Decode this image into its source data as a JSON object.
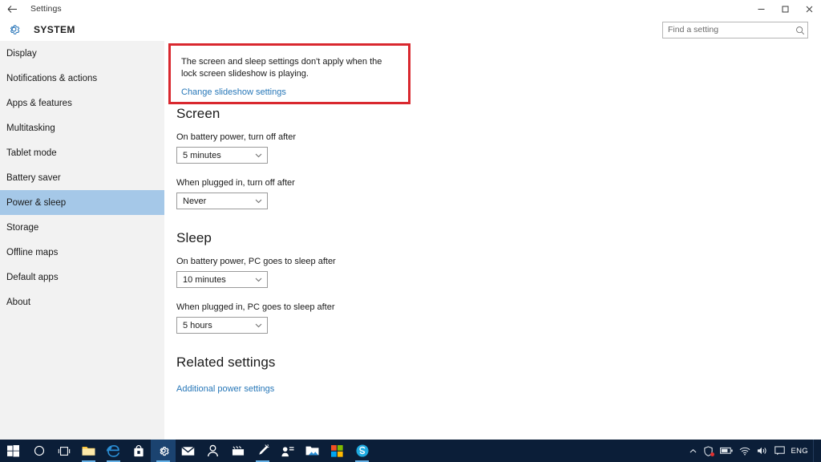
{
  "window": {
    "title": "Settings",
    "back_icon": "back-arrow-icon",
    "controls": {
      "minimize": "minimize-icon",
      "maximize": "maximize-icon",
      "close": "close-icon"
    }
  },
  "header": {
    "icon": "gear-icon",
    "title": "SYSTEM"
  },
  "search": {
    "placeholder": "Find a setting",
    "value": "",
    "icon": "search-icon"
  },
  "sidebar": {
    "items": [
      {
        "label": "Display",
        "selected": false
      },
      {
        "label": "Notifications & actions",
        "selected": false
      },
      {
        "label": "Apps & features",
        "selected": false
      },
      {
        "label": "Multitasking",
        "selected": false
      },
      {
        "label": "Tablet mode",
        "selected": false
      },
      {
        "label": "Battery saver",
        "selected": false
      },
      {
        "label": "Power & sleep",
        "selected": true
      },
      {
        "label": "Storage",
        "selected": false
      },
      {
        "label": "Offline maps",
        "selected": false
      },
      {
        "label": "Default apps",
        "selected": false
      },
      {
        "label": "About",
        "selected": false
      }
    ],
    "selected_bg": "#a5c8e8"
  },
  "info_box": {
    "text": "The screen and sleep settings don't apply when the lock screen slideshow is playing.",
    "link": "Change slideshow settings",
    "highlight_color": "#d9282f"
  },
  "screen_section": {
    "title": "Screen",
    "fields": [
      {
        "label": "On battery power, turn off after",
        "value": "5 minutes"
      },
      {
        "label": "When plugged in, turn off after",
        "value": "Never"
      }
    ]
  },
  "sleep_section": {
    "title": "Sleep",
    "fields": [
      {
        "label": "On battery power, PC goes to sleep after",
        "value": "10 minutes"
      },
      {
        "label": "When plugged in, PC goes to sleep after",
        "value": "5 hours"
      }
    ]
  },
  "related_section": {
    "title": "Related settings",
    "link": "Additional power settings"
  },
  "taskbar": {
    "items": [
      {
        "name": "start-button",
        "icon": "windows-logo-icon"
      },
      {
        "name": "cortana-button",
        "icon": "circle-icon"
      },
      {
        "name": "task-view-button",
        "icon": "task-view-icon"
      },
      {
        "name": "file-explorer-button",
        "icon": "folder-icon"
      },
      {
        "name": "edge-button",
        "icon": "edge-icon"
      },
      {
        "name": "store-button",
        "icon": "shopping-bag-icon"
      },
      {
        "name": "settings-button",
        "icon": "gear-icon"
      },
      {
        "name": "mail-button",
        "icon": "envelope-icon"
      },
      {
        "name": "people-button",
        "icon": "person-icon"
      },
      {
        "name": "movies-button",
        "icon": "clapperboard-icon"
      },
      {
        "name": "sketch-button",
        "icon": "pen-icon"
      },
      {
        "name": "contacts-button",
        "icon": "person-card-icon"
      },
      {
        "name": "photos-button",
        "icon": "photo-folder-icon"
      },
      {
        "name": "microsoft-store-button",
        "icon": "store-tiles-icon"
      },
      {
        "name": "skype-button",
        "icon": "skype-icon"
      }
    ],
    "tray": {
      "chevron": "chevron-up-icon",
      "security": "security-shield-icon",
      "battery": "battery-icon",
      "network": "wifi-icon",
      "volume": "speaker-icon",
      "action_center": "notification-icon",
      "language": "ENG"
    },
    "background": "#0b1e38"
  }
}
